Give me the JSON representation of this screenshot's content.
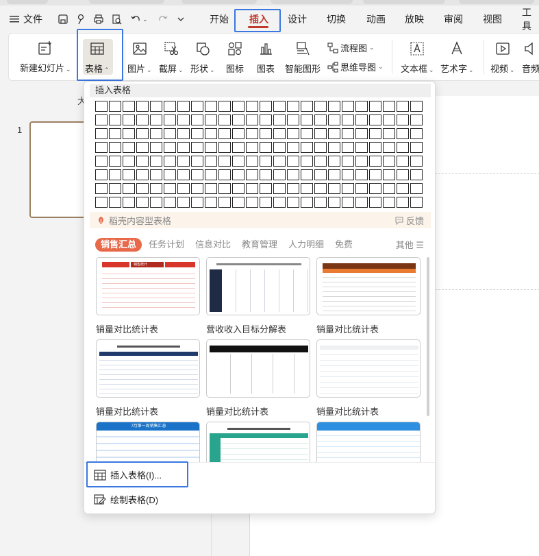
{
  "menu": {
    "file_label": "文件",
    "tabs": [
      {
        "label": "开始"
      },
      {
        "label": "插入"
      },
      {
        "label": "设计"
      },
      {
        "label": "切换"
      },
      {
        "label": "动画"
      },
      {
        "label": "放映"
      },
      {
        "label": "审阅"
      },
      {
        "label": "视图"
      },
      {
        "label": "工具"
      }
    ],
    "active_tab": "插入"
  },
  "ribbon": {
    "new_slide": "新建幻灯片",
    "table": "表格",
    "picture": "图片",
    "screenshot": "截屏",
    "shape": "形状",
    "icon": "图标",
    "chart": "图表",
    "smartart": "智能图形",
    "flowchart": "流程图",
    "mindmap": "思维导图",
    "textbox": "文本框",
    "wordart": "艺术字",
    "video": "视频",
    "audio": "音频"
  },
  "slides": {
    "thumb_number": "1",
    "pane_heading_partial": "大"
  },
  "dropdown": {
    "title": "插入表格",
    "grid_cols": 24,
    "grid_rows": 8,
    "daoke_label": "稻壳内容型表格",
    "feedback_label": "反馈",
    "categories": [
      {
        "label": "销售汇总"
      },
      {
        "label": "任务计划"
      },
      {
        "label": "信息对比"
      },
      {
        "label": "教育管理"
      },
      {
        "label": "人力明细"
      },
      {
        "label": "免费"
      }
    ],
    "more_label": "其他 ☰",
    "templates": [
      {
        "name": "销量对比统计表",
        "accent": "#d9362b"
      },
      {
        "name": "营收收入目标分解表",
        "accent": "#1f2a44"
      },
      {
        "name": "销量对比统计表",
        "accent": "#c9561f"
      },
      {
        "name": "销量对比统计表",
        "accent": "#1f3a6b"
      },
      {
        "name": "销量对比统计表",
        "accent": "#111111"
      },
      {
        "name": "销量对比统计表",
        "accent": "#9aa7b3"
      },
      {
        "name": "",
        "accent": "#1a73c9"
      },
      {
        "name": "",
        "accent": "#2aa58d"
      },
      {
        "name": "",
        "accent": "#2e8fe0"
      }
    ],
    "template_captions": {
      "t1": "销售统计",
      "t6": "7月第一周销售汇总"
    },
    "insert_table_option": "插入表格(I)...",
    "draw_table_option": "绘制表格(D)"
  },
  "colors": {
    "accent_red": "#c0392b",
    "highlight_blue": "#3a77e0",
    "category_active": "#e8694a"
  }
}
